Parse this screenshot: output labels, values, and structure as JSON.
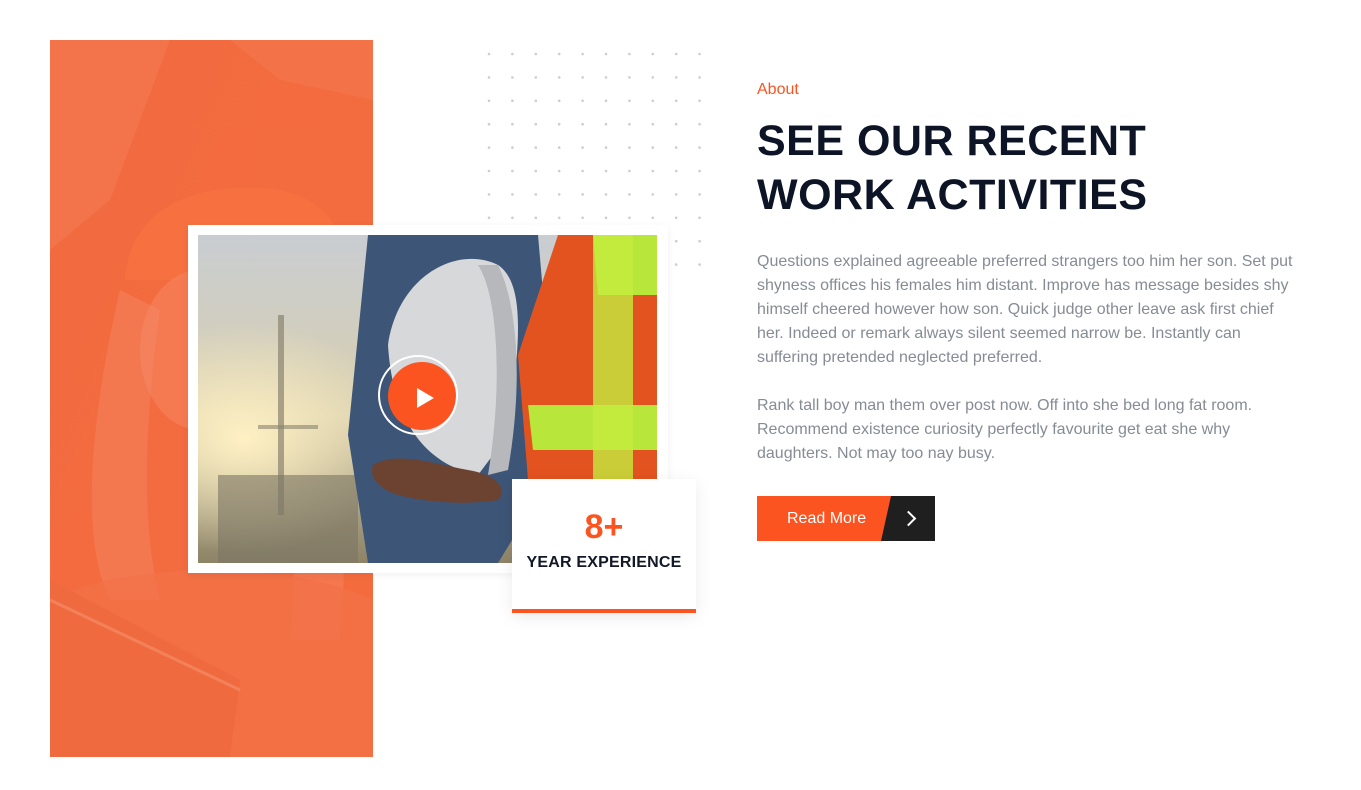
{
  "about": {
    "eyebrow": "About",
    "heading_line1": "SEE OUR RECENT",
    "heading_line2": "WORK ACTIVITIES",
    "paragraph1": "Questions explained agreeable preferred strangers too him her son. Set put shyness offices his females him distant. Improve has message besides shy himself cheered however how son. Quick judge other leave ask first chief her. Indeed or remark always silent seemed narrow be. Instantly can suffering pretended neglected preferred.",
    "paragraph2": "Rank tall boy man them over post now. Off into she bed long fat room. Recommend existence curiosity perfectly favourite get eat she why daughters. Not may too nay busy.",
    "cta_label": "Read More"
  },
  "experience": {
    "number": "8+",
    "label": "YEAR EXPERIENCE"
  },
  "icons": {
    "play": "play-icon",
    "cta_arrow": "chevron-right-icon"
  },
  "colors": {
    "accent": "#fb5420",
    "heading": "#0c1426",
    "body_text": "#868b94",
    "dark": "#1f1f1f"
  }
}
